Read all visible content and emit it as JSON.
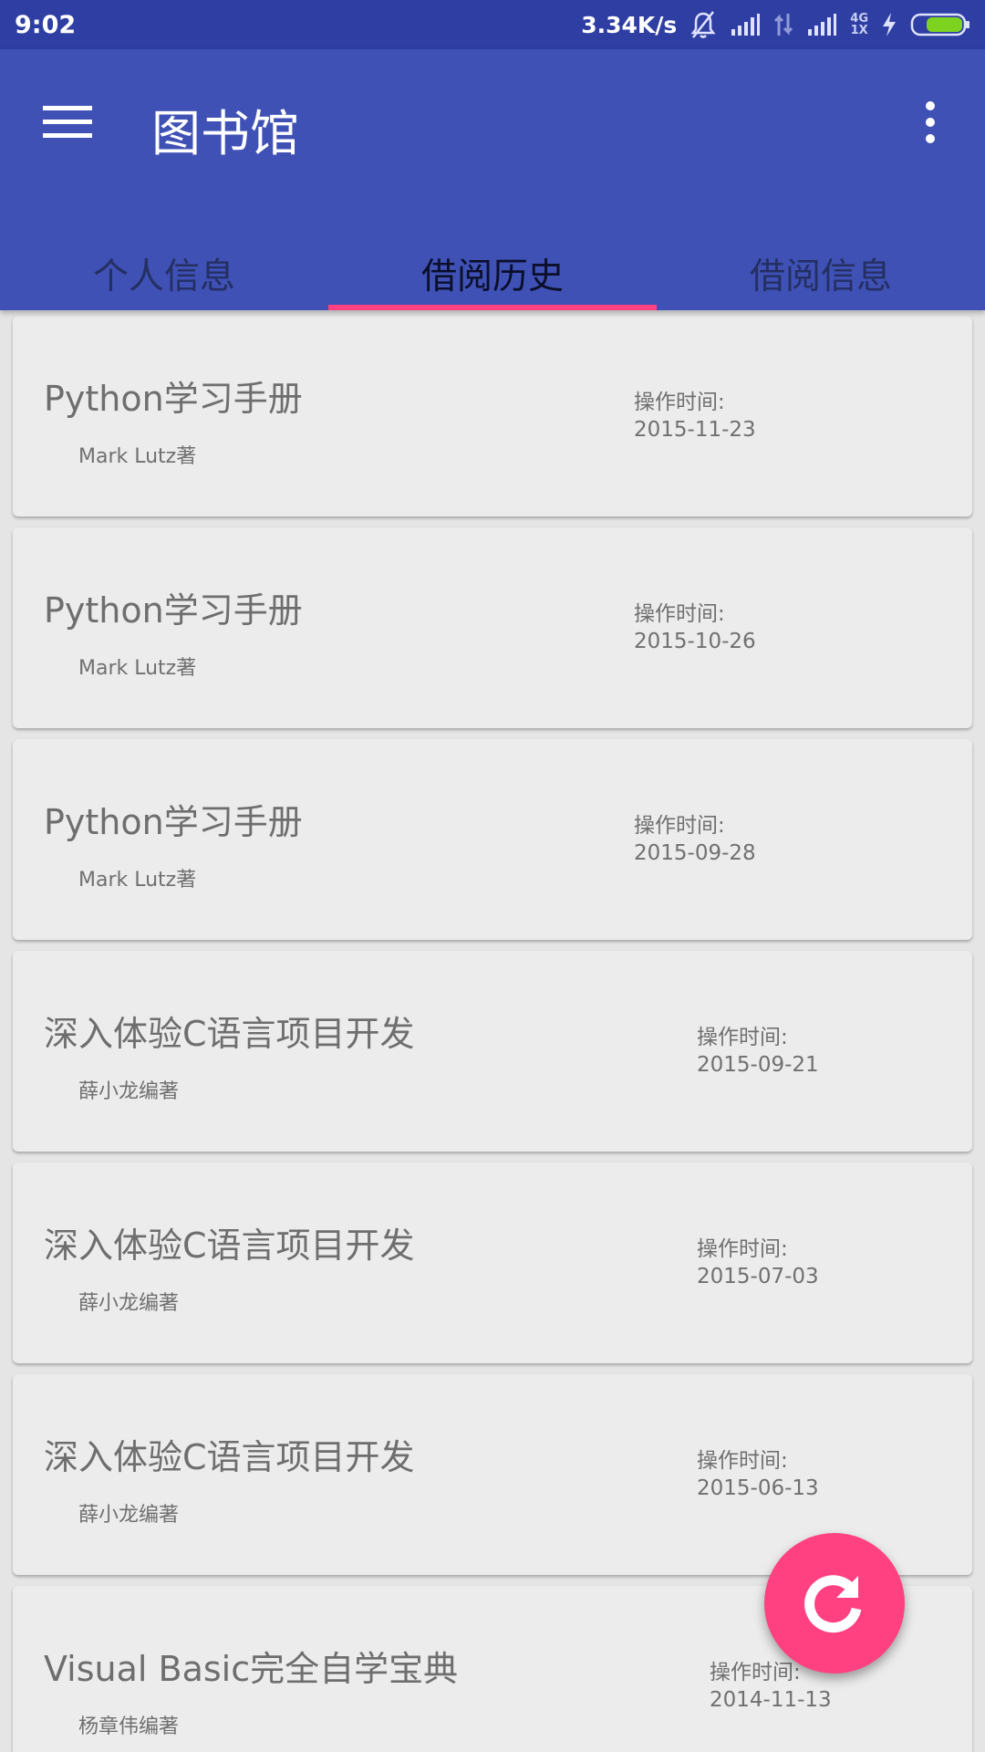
{
  "status_bar": {
    "time": "9:02",
    "speed": "3.34K/s",
    "net_top": "4G",
    "net_bottom": "1X",
    "battery_color": "#7ed321",
    "icons": [
      "bell-off-icon",
      "signal-icon",
      "data-arrows-icon",
      "signal-icon-2",
      "charging-icon",
      "battery-icon"
    ]
  },
  "app_bar": {
    "title": "图书馆",
    "color": "#3f51b5",
    "menu_icon": "hamburger-menu-icon",
    "overflow_icon": "more-vert-icon"
  },
  "tabs": [
    {
      "label": "个人信息",
      "active": false
    },
    {
      "label": "借阅历史",
      "active": true
    },
    {
      "label": "借阅信息",
      "active": false
    }
  ],
  "accent_color": "#ff4081",
  "history": [
    {
      "title": "Python学习手册",
      "author": "Mark Lutz著",
      "time_label": "操作时间:",
      "date": "2015-11-23"
    },
    {
      "title": "Python学习手册",
      "author": "Mark Lutz著",
      "time_label": "操作时间:",
      "date": "2015-10-26"
    },
    {
      "title": "Python学习手册",
      "author": "Mark Lutz著",
      "time_label": "操作时间:",
      "date": "2015-09-28"
    },
    {
      "title": "深入体验C语言项目开发",
      "author": "薛小龙编著",
      "time_label": "操作时间:",
      "date": "2015-09-21"
    },
    {
      "title": "深入体验C语言项目开发",
      "author": "薛小龙编著",
      "time_label": "操作时间:",
      "date": "2015-07-03"
    },
    {
      "title": "深入体验C语言项目开发",
      "author": "薛小龙编著",
      "time_label": "操作时间:",
      "date": "2015-06-13"
    },
    {
      "title": "Visual Basic完全自学宝典",
      "author": "杨章伟编著",
      "time_label": "操作时间:",
      "date": "2014-11-13"
    }
  ],
  "fab": {
    "icon": "refresh-icon"
  }
}
